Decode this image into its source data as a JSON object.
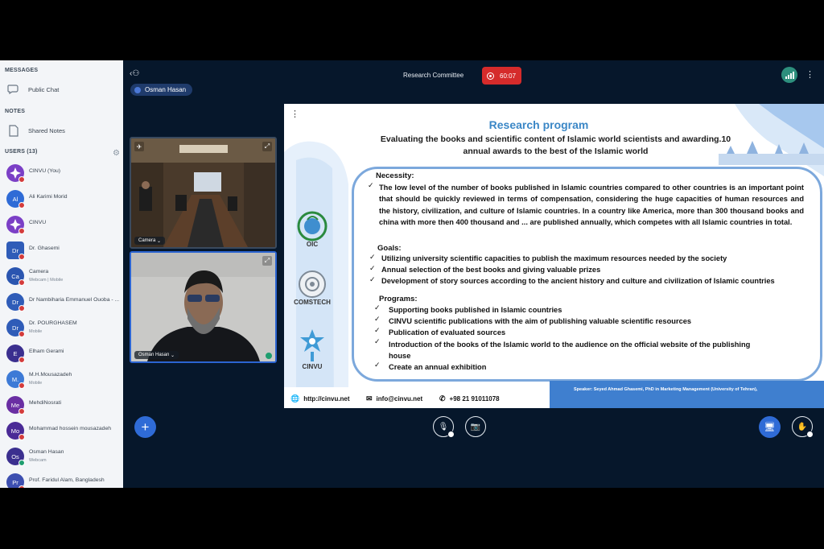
{
  "sidebar": {
    "messages_title": "MESSAGES",
    "public_chat": "Public Chat",
    "notes_title": "NOTES",
    "shared_notes": "Shared Notes",
    "users_title": "USERS (13)",
    "users": [
      {
        "initials": "",
        "name": "CINVU (You)",
        "sub": "",
        "color": "#7b3fc6"
      },
      {
        "initials": "Al",
        "name": "Ali Karimi Morid",
        "sub": "",
        "color": "#2f6bd6"
      },
      {
        "initials": "",
        "name": "CINVU",
        "sub": "",
        "color": "#7b3fc6"
      },
      {
        "initials": "Dr",
        "name": "Dr. Ghasemi",
        "sub": "",
        "color": "#2f5cb8"
      },
      {
        "initials": "Ca",
        "name": "Camera",
        "sub": "Webcam | Mobile",
        "color": "#2a55b0"
      },
      {
        "initials": "Dr",
        "name": "Dr Nambiharia Emmanuel Ouoba - ...",
        "sub": "",
        "color": "#2f5cb8"
      },
      {
        "initials": "Dr",
        "name": "Dr. POURGHASEM",
        "sub": "Mobile",
        "color": "#2f5cb8"
      },
      {
        "initials": "E",
        "name": "Elham Gerami",
        "sub": "",
        "color": "#3b2f8f"
      },
      {
        "initials": "M.",
        "name": "M.H.Mousazadeh",
        "sub": "Mobile",
        "color": "#3d7ad6"
      },
      {
        "initials": "Me",
        "name": "MehdiNosrati",
        "sub": "",
        "color": "#6a2ea3"
      },
      {
        "initials": "Mo",
        "name": "Mohammad hossein mousazadeh",
        "sub": "",
        "color": "#4a2a96"
      },
      {
        "initials": "Os",
        "name": "Osman Hasan",
        "sub": "Webcam",
        "color": "#3b2f8f"
      },
      {
        "initials": "Pr",
        "name": "Prof. Faridul Alam, Bangladesh",
        "sub": "",
        "color": "#3d4fb0"
      }
    ]
  },
  "header": {
    "meeting_title": "Research Committee",
    "record_time": "60:07",
    "presenter": "Osman Hasan"
  },
  "videos": {
    "tile1_label": "Camera",
    "tile2_label": "Osman Hasan"
  },
  "slide": {
    "title": "Research program",
    "subtitle_line1": "Evaluating the books and scientific content of Islamic world scientists and awarding.10",
    "subtitle_line2": "annual awards to the best of the Islamic world",
    "necessity_heading": "Necessity:",
    "necessity_text": "The low level of the number of books published in Islamic countries compared to other countries is an important point that should be quickly reviewed in terms of compensation, considering the huge capacities of human resources and the history, civilization, and culture of Islamic countries. In a country like America, more than 300  thousand books and china with more then 400 thousand and ... are published annually, which competes with all Islamic countries in total.",
    "goals_heading": "Goals:",
    "goals": [
      "Utilizing university scientific capacities to publish the maximum resources needed by the society",
      "Annual selection of the best books and giving valuable prizes",
      "Development of story sources according to the ancient history and culture and civilization of Islamic countries"
    ],
    "programs_heading": "Programs:",
    "programs": [
      "Supporting books published in Islamic countries",
      "CINVU scientific publications with the aim of publishing valuable scientific resources",
      "Publication of evaluated sources",
      "Introduction of the books of the Islamic world to the audience on the official website of the publishing",
      "house",
      "Create an annual exhibition"
    ],
    "logos": [
      "OIC",
      "COMSTECH",
      "CINVU"
    ],
    "footer_web": "http://cinvu.net",
    "footer_email": "info@cinvu.net",
    "footer_phone": "+98 21 91011078",
    "speaker": "Speaker: Seyed Ahmad Ghasemi, PhD in Marketing Management (University of Tehran),"
  },
  "colors": {
    "accent": "#2f6bd6",
    "record": "#d52b2b",
    "main_bg": "#06172b",
    "slide_title": "#3b87c6"
  }
}
